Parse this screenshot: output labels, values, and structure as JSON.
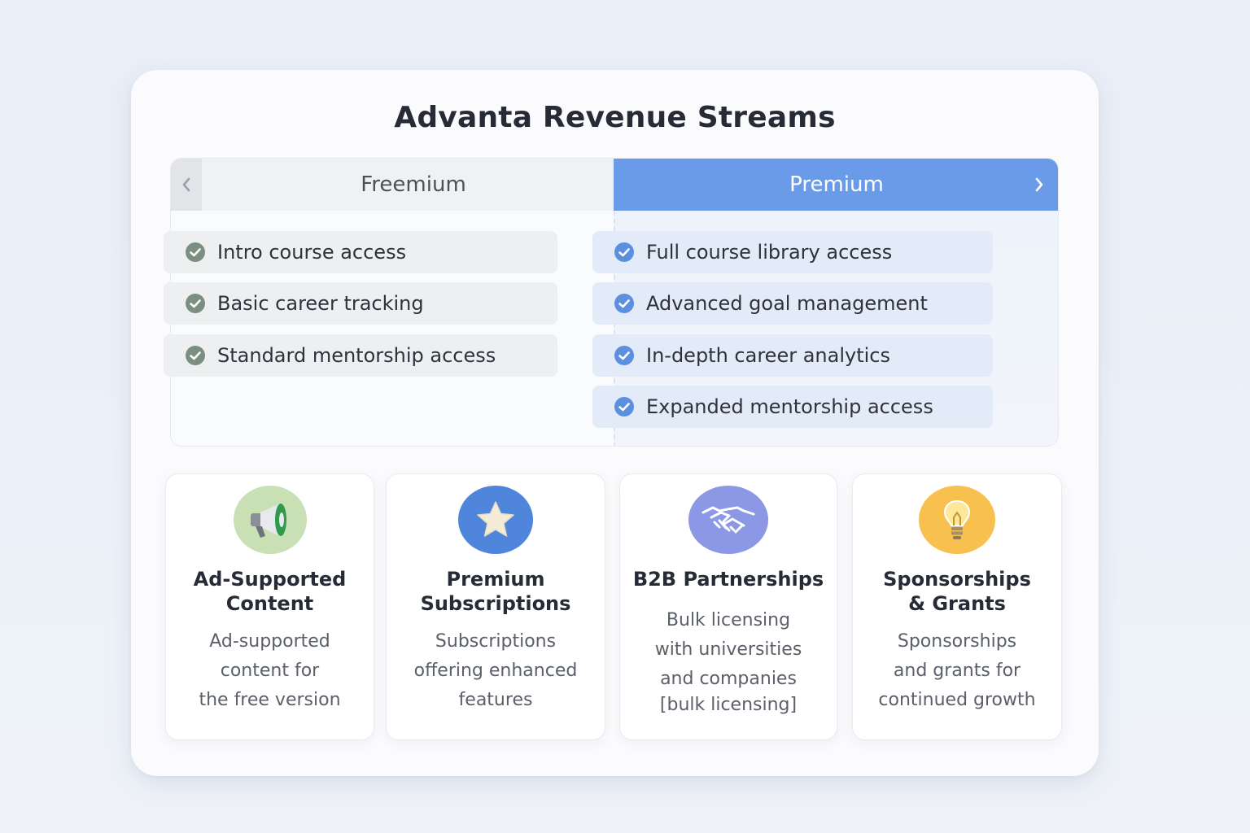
{
  "title": "Advanta Revenue Streams",
  "tabs": {
    "freemium": "Freemium",
    "premium": "Premium"
  },
  "freemium_features": [
    "Intro course access",
    "Basic career tracking",
    "Standard mentorship access"
  ],
  "premium_features": [
    "Full course library access",
    "Advanced goal management",
    "In-depth career analytics",
    "Expanded mentorship access"
  ],
  "streams": [
    {
      "icon": "megaphone-icon",
      "title_lines": [
        "Ad-Supported",
        "Content"
      ],
      "desc_lines": [
        "Ad-supported",
        "content for",
        "the free version"
      ]
    },
    {
      "icon": "star-icon",
      "title_lines": [
        "Premium",
        "Subscriptions"
      ],
      "desc_lines": [
        "Subscriptions",
        "offering enhanced",
        "features"
      ]
    },
    {
      "icon": "handshake-icon",
      "title_lines": [
        "B2B Partnerships"
      ],
      "desc_lines": [
        "Bulk licensing",
        "with universities",
        "and companies",
        "[bulk licensing]"
      ]
    },
    {
      "icon": "lightbulb-icon",
      "title_lines": [
        "Sponsorships",
        "& Grants"
      ],
      "desc_lines": [
        "Sponsorships",
        "and grants for",
        "continued growth"
      ]
    }
  ],
  "colors": {
    "premium_tab": "#6a9be8",
    "free_check": "#7a8f80",
    "premium_check": "#5b8fe0",
    "ad_icon_bg": "#c9dfb4",
    "star_icon_bg": "#4f86dc",
    "handshake_icon_bg": "#8c98e6",
    "bulb_icon_bg": "#f8c04f"
  }
}
